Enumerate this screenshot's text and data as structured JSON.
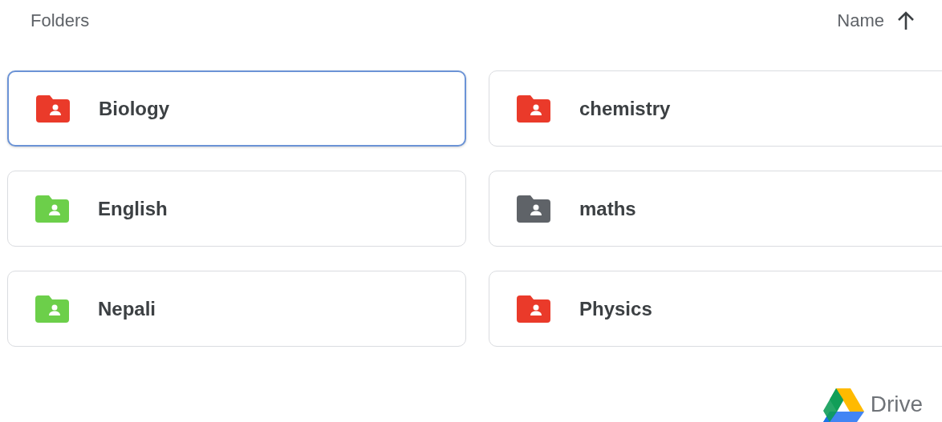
{
  "header": {
    "title": "Folders",
    "sort": {
      "label": "Name",
      "ascending": true
    }
  },
  "folders": [
    {
      "name": "Biology",
      "color": "#ea3a2a",
      "selected": true
    },
    {
      "name": "chemistry",
      "color": "#ea3a2a",
      "selected": false
    },
    {
      "name": "English",
      "color": "#6ccf4a",
      "selected": false
    },
    {
      "name": "maths",
      "color": "#5f6368",
      "selected": false
    },
    {
      "name": "Nepali",
      "color": "#6ccf4a",
      "selected": false
    },
    {
      "name": "Physics",
      "color": "#ea3a2a",
      "selected": false
    }
  ],
  "brand": {
    "name": "Drive"
  }
}
